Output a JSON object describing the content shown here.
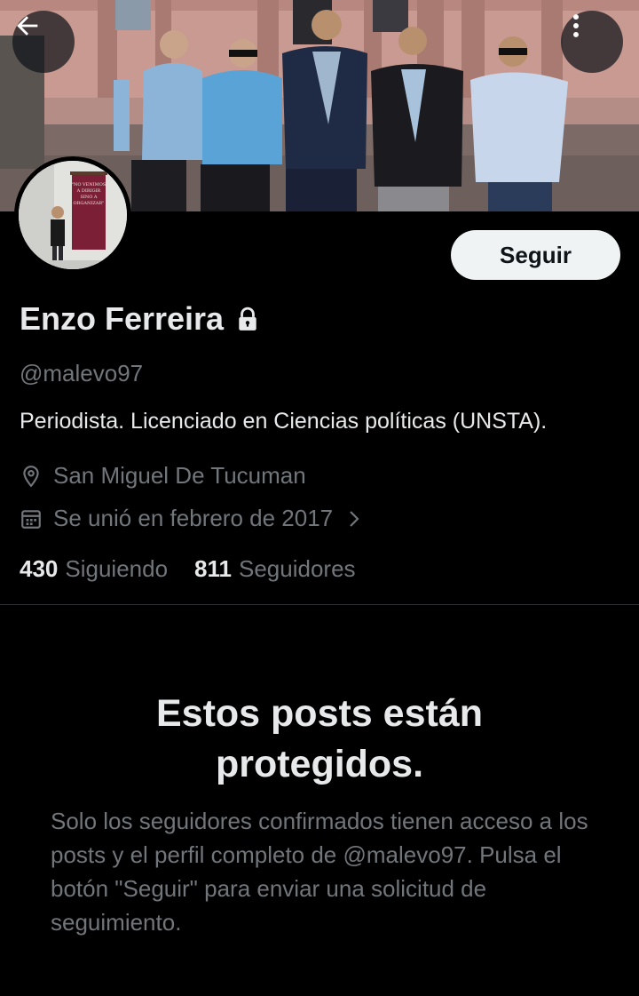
{
  "header": {
    "back_icon": "arrow-left-icon",
    "more_icon": "more-vertical-icon"
  },
  "profile": {
    "name": "Enzo Ferreira",
    "handle": "@malevo97",
    "bio": "Periodista. Licenciado en Ciencias políticas (UNSTA).",
    "location": "San Miguel De Tucuman",
    "joined": "Se unió en febrero de 2017",
    "following_count": "430",
    "following_label": "Siguiendo",
    "followers_count": "811",
    "followers_label": "Seguidores",
    "follow_button": "Seguir",
    "locked": true
  },
  "avatar": {
    "banner_text_lines": [
      "\"NO VENIMOS",
      "A DIRIGIR",
      "SINO A",
      "ORGANIZAR\""
    ]
  },
  "protected": {
    "title": "Estos posts están protegidos.",
    "message": "Solo los seguidores confirmados tienen acceso a los posts y el perfil completo de @malevo97. Pulsa el botón \"Seguir\" para enviar una solicitud de seguimiento."
  },
  "colors": {
    "background": "#000000",
    "primary_text": "#e7e9ea",
    "secondary_text": "#71767b",
    "follow_button_bg": "#eff3f4"
  }
}
